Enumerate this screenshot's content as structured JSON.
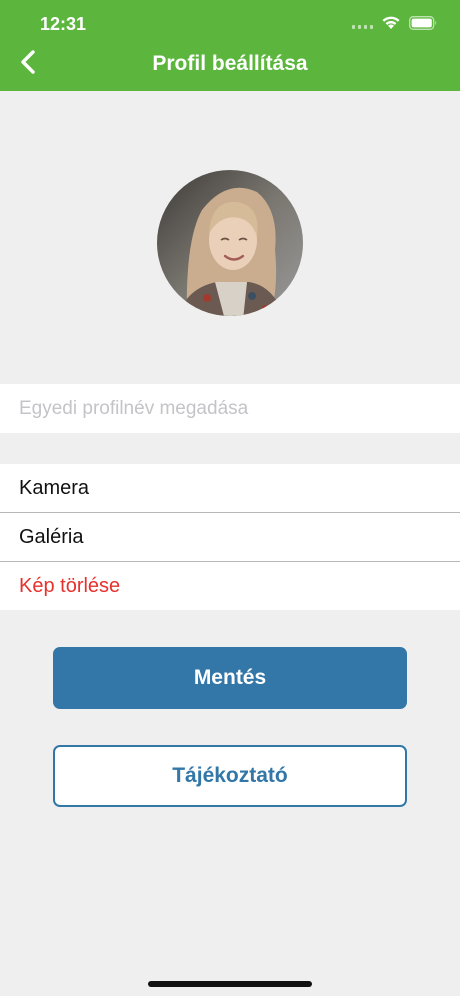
{
  "status_bar": {
    "time": "12:31"
  },
  "header": {
    "title": "Profil beállítása",
    "background_color": "#5cb63e"
  },
  "profile": {
    "name_placeholder": "Egyedi profilnév megadása",
    "name_value": ""
  },
  "photo_options": [
    {
      "label": "Kamera"
    },
    {
      "label": "Galéria"
    },
    {
      "label": "Kép törlése",
      "color": "#e8312d"
    }
  ],
  "actions": {
    "save_label": "Mentés",
    "info_label": "Tájékoztató",
    "accent_color": "#3277a8"
  }
}
